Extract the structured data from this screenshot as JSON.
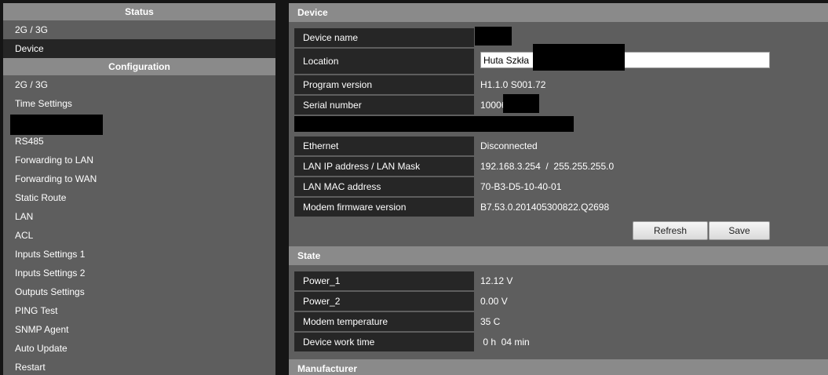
{
  "sidebar": {
    "status": {
      "header": "Status",
      "items": [
        "2G / 3G",
        "Device"
      ]
    },
    "configuration": {
      "header": "Configuration",
      "items_before_redaction": [
        "2G / 3G",
        "Time Settings"
      ],
      "items_after_redaction": [
        "RS485",
        "Forwarding to LAN",
        "Forwarding to WAN",
        "Static Route",
        "LAN",
        "ACL",
        "Inputs Settings 1",
        "Inputs Settings 2",
        "Outputs Settings",
        "PING Test",
        "SNMP Agent",
        "Auto Update",
        "Restart"
      ]
    }
  },
  "device": {
    "header": "Device",
    "device_name_label": "Device name",
    "location_label": "Location",
    "location_value": "Huta Szkła",
    "program_version_label": "Program version",
    "program_version_value": "H1.1.0 S001.72",
    "serial_number_label": "Serial number",
    "serial_number_value": "10006",
    "ethernet_label": "Ethernet",
    "ethernet_value": "Disconnected",
    "lan_ip_label": "LAN IP address / LAN Mask",
    "lan_ip_value": "192.168.3.254  /  255.255.255.0",
    "lan_mac_label": "LAN MAC address",
    "lan_mac_value": "70-B3-D5-10-40-01",
    "modem_fw_label": "Modem firmware version",
    "modem_fw_value": "B7.53.0.201405300822.Q2698",
    "refresh_label": "Refresh",
    "save_label": "Save"
  },
  "state": {
    "header": "State",
    "power1_label": "Power_1",
    "power1_value": "12.12 V",
    "power2_label": "Power_2",
    "power2_value": "0.00 V",
    "modem_temp_label": "Modem temperature",
    "modem_temp_value": "35 C",
    "work_time_label": "Device work time",
    "work_time_value": " 0 h  04 min"
  },
  "manufacturer": {
    "header": "Manufacturer"
  },
  "colors": {
    "page_background": "#151515",
    "panel_background": "#5e5e5e",
    "header_background": "#8a8a8a",
    "label_background": "#262626",
    "active_item_background": "#252525",
    "redaction": "#000000"
  }
}
